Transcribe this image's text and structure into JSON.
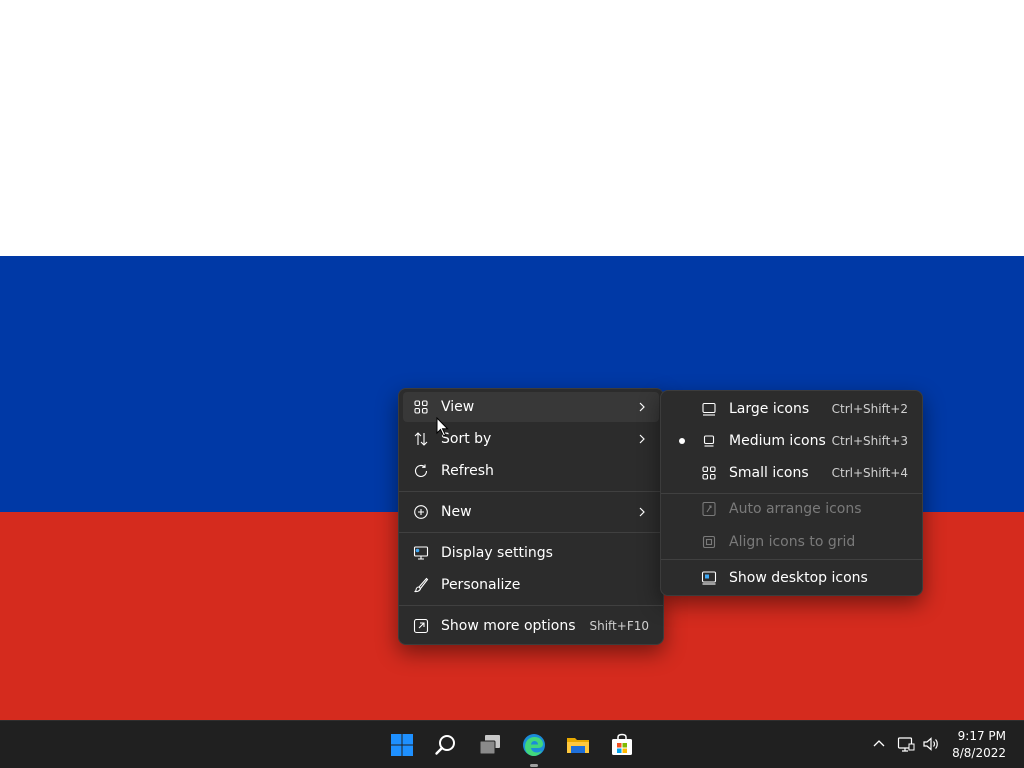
{
  "wallpaper": {
    "colors": [
      "#ffffff",
      "#0039a6",
      "#d52b1e"
    ]
  },
  "context_menu": {
    "items": [
      {
        "label": "View",
        "icon": "grid-icon",
        "has_submenu": true
      },
      {
        "label": "Sort by",
        "icon": "sort-icon",
        "has_submenu": true
      },
      {
        "label": "Refresh",
        "icon": "refresh-icon"
      },
      {
        "label": "New",
        "icon": "plus-circle-icon",
        "has_submenu": true
      },
      {
        "label": "Display settings",
        "icon": "display-settings-icon"
      },
      {
        "label": "Personalize",
        "icon": "brush-icon"
      },
      {
        "label": "Show more options",
        "icon": "expand-icon",
        "shortcut": "Shift+F10"
      }
    ]
  },
  "view_submenu": {
    "items": [
      {
        "label": "Large icons",
        "icon": "large-icons-icon",
        "shortcut": "Ctrl+Shift+2"
      },
      {
        "label": "Medium icons",
        "icon": "medium-icons-icon",
        "shortcut": "Ctrl+Shift+3",
        "selected": true
      },
      {
        "label": "Small icons",
        "icon": "small-icons-icon",
        "shortcut": "Ctrl+Shift+4"
      },
      {
        "label": "Auto arrange icons",
        "icon": "auto-arrange-icon",
        "disabled": true
      },
      {
        "label": "Align icons to grid",
        "icon": "align-grid-icon",
        "disabled": true
      },
      {
        "label": "Show desktop icons",
        "icon": "show-desktop-icon"
      }
    ]
  },
  "taskbar": {
    "apps": [
      "windows-start-icon",
      "search-icon",
      "task-view-icon",
      "edge-icon",
      "file-explorer-icon",
      "microsoft-store-icon"
    ]
  },
  "clock": {
    "time": "9:17 PM",
    "date": "8/8/2022"
  }
}
